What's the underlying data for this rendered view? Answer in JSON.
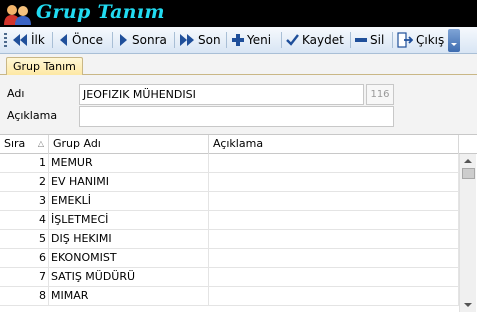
{
  "window": {
    "title": "Grup Tanım"
  },
  "toolbar": {
    "first_label": "İlk",
    "prev_label": "Önce",
    "next_label": "Sonra",
    "last_label": "Son",
    "new_label": "Yeni",
    "save_label": "Kaydet",
    "delete_label": "Sil",
    "exit_label": "Çıkış"
  },
  "tabs": [
    {
      "label": "Grup Tanım"
    }
  ],
  "form": {
    "name_label": "Adı",
    "name_value": "JEOFIZIK MÜHENDISI",
    "name_counter": "116",
    "desc_label": "Açıklama",
    "desc_value": ""
  },
  "grid": {
    "columns": [
      "Sıra",
      "Grup Adı",
      "Açıklama"
    ],
    "rows": [
      {
        "sira": "1",
        "ad": "MEMUR",
        "aciklama": ""
      },
      {
        "sira": "2",
        "ad": "EV HANIMI",
        "aciklama": ""
      },
      {
        "sira": "3",
        "ad": "EMEKLİ",
        "aciklama": ""
      },
      {
        "sira": "4",
        "ad": "İŞLETMECİ",
        "aciklama": ""
      },
      {
        "sira": "5",
        "ad": "DIŞ HEKIMI",
        "aciklama": ""
      },
      {
        "sira": "6",
        "ad": "EKONOMIST",
        "aciklama": ""
      },
      {
        "sira": "7",
        "ad": "SATIŞ MÜDÜRÜ",
        "aciklama": ""
      },
      {
        "sira": "8",
        "ad": "MIMAR",
        "aciklama": ""
      }
    ]
  },
  "colors": {
    "title_text": "#22dcf2",
    "title_bg": "#000000",
    "toolbar_icon": "#1f4f9a",
    "tab_bg": "#fde7a0"
  }
}
